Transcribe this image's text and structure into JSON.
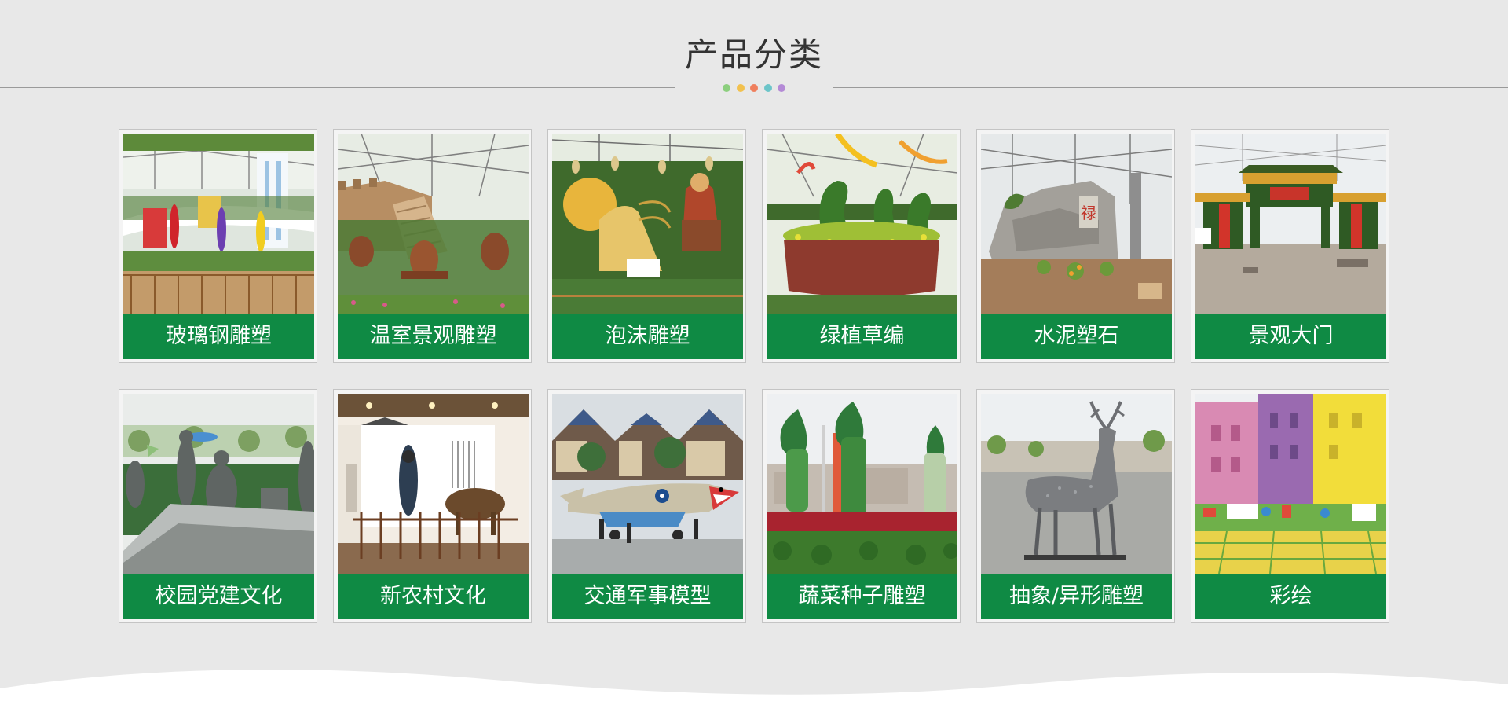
{
  "section": {
    "title": "产品分类",
    "dot_colors": [
      "#8ccf7e",
      "#f2c14e",
      "#ef7f5d",
      "#6cc5c9",
      "#b48ad6"
    ]
  },
  "categories": [
    {
      "label": "玻璃钢雕塑",
      "image": "fiberglass-sculpture-photo"
    },
    {
      "label": "温室景观雕塑",
      "image": "greenhouse-landscape-sculpture-photo"
    },
    {
      "label": "泡沫雕塑",
      "image": "foam-sculpture-photo"
    },
    {
      "label": "绿植草编",
      "image": "green-plant-topiary-photo"
    },
    {
      "label": "水泥塑石",
      "image": "cement-rockwork-photo"
    },
    {
      "label": "景观大门",
      "image": "landscape-gate-photo"
    },
    {
      "label": "校园党建文化",
      "image": "campus-culture-sculpture-photo"
    },
    {
      "label": "新农村文化",
      "image": "new-rural-culture-photo"
    },
    {
      "label": "交通军事模型",
      "image": "military-aircraft-model-photo"
    },
    {
      "label": "蔬菜种子雕塑",
      "image": "vegetable-seed-sculpture-photo"
    },
    {
      "label": "抽象/异形雕塑",
      "image": "abstract-deer-sculpture-photo"
    },
    {
      "label": "彩绘",
      "image": "wall-painting-photo"
    }
  ],
  "colors": {
    "caption_bg": "#0f8a44",
    "page_bg": "#e8e8e8"
  }
}
